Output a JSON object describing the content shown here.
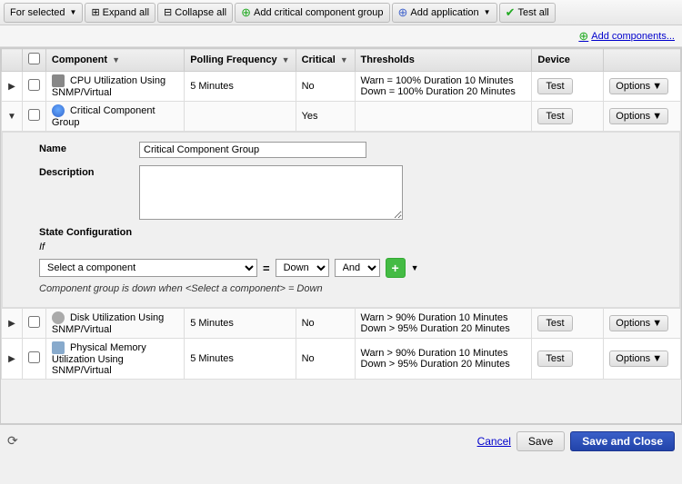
{
  "toolbar": {
    "for_selected_label": "For selected",
    "expand_all_label": "Expand all",
    "collapse_all_label": "Collapse all",
    "add_critical_label": "Add critical component group",
    "add_application_label": "Add application",
    "test_all_label": "Test all",
    "add_components_label": "Add components..."
  },
  "table": {
    "headers": {
      "component": "Component",
      "polling": "Polling Frequency",
      "critical": "Critical",
      "thresholds": "Thresholds",
      "device": "Device"
    },
    "rows": [
      {
        "id": "cpu",
        "component": "CPU Utilization Using SNMP/Virtual",
        "polling": "5 Minutes",
        "critical": "No",
        "thresholds_line1": "Warn = 100% Duration 10 Minutes",
        "thresholds_line2": "Down = 100% Duration 20 Minutes",
        "device": "",
        "test_label": "Test",
        "options_label": "Options",
        "expanded": false,
        "icon": "cpu"
      },
      {
        "id": "ccg",
        "component": "Critical Component Group",
        "polling": "",
        "critical": "Yes",
        "thresholds_line1": "",
        "thresholds_line2": "",
        "device": "",
        "test_label": "Test",
        "options_label": "Options",
        "expanded": true,
        "icon": "group"
      },
      {
        "id": "disk",
        "component": "Disk Utilization Using SNMP/Virtual",
        "polling": "5 Minutes",
        "critical": "No",
        "thresholds_line1": "Warn > 90% Duration 10 Minutes",
        "thresholds_line2": "Down > 95% Duration 20 Minutes",
        "device": "",
        "test_label": "Test",
        "options_label": "Options",
        "expanded": false,
        "icon": "disk"
      },
      {
        "id": "memory",
        "component": "Physical Memory Utilization Using SNMP/Virtual",
        "polling": "5 Minutes",
        "critical": "No",
        "thresholds_line1": "Warn > 90% Duration 10 Minutes",
        "thresholds_line2": "Down > 95% Duration 20 Minutes",
        "device": "",
        "test_label": "Test",
        "options_label": "Options",
        "expanded": false,
        "icon": "memory"
      }
    ]
  },
  "detail": {
    "name_label": "Name",
    "name_value": "Critical Component Group",
    "description_label": "Description",
    "description_value": "",
    "state_config_label": "State Configuration",
    "if_label": "If",
    "select_placeholder": "Select a component",
    "equals": "=",
    "down_value": "Down",
    "and_label": "And",
    "state_description": "Component group is down when <Select a component> = Down"
  },
  "footer": {
    "cancel_label": "Cancel",
    "save_label": "Save",
    "save_close_label": "Save and Close"
  }
}
